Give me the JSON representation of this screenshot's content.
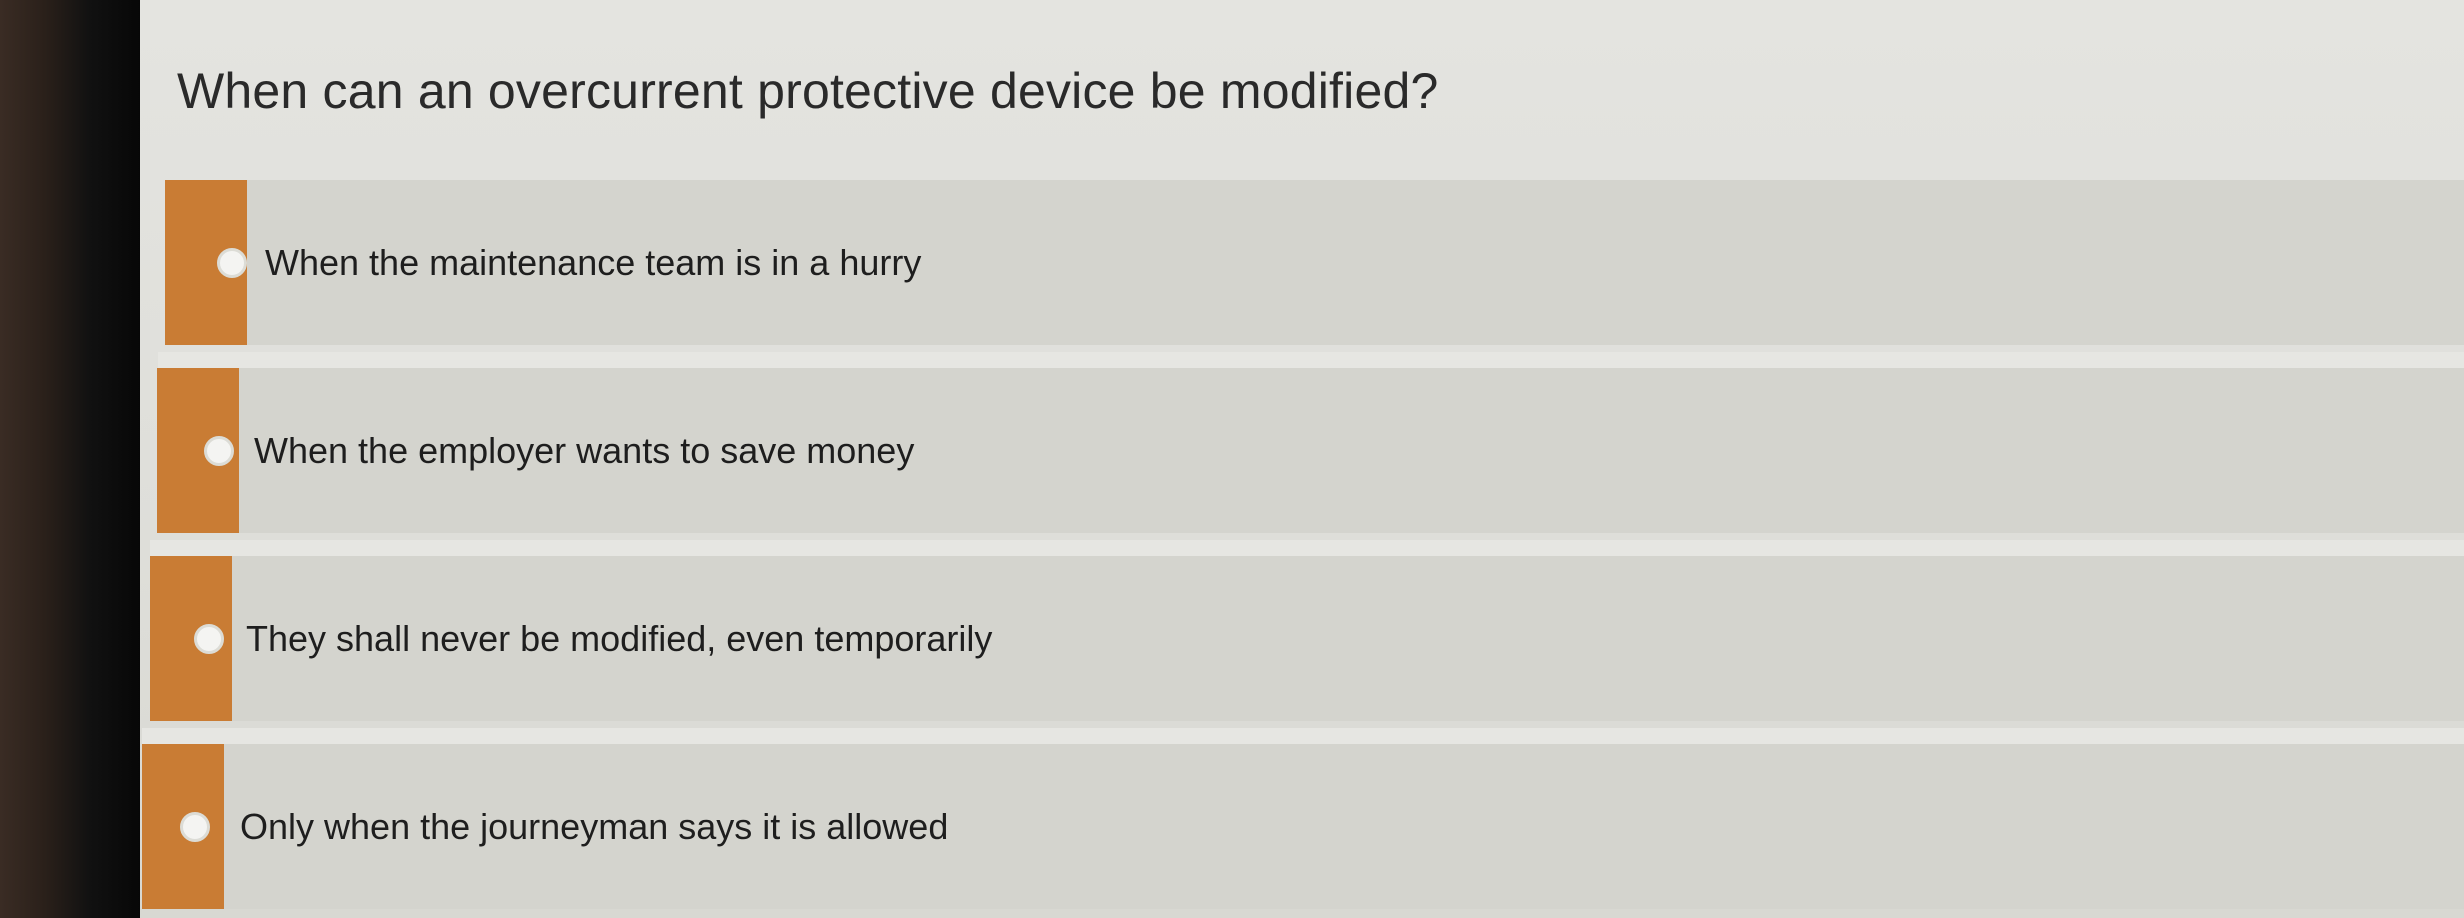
{
  "quiz": {
    "question": "When can an overcurrent protective device be modified?",
    "options": [
      {
        "label": "When the maintenance team is in a hurry"
      },
      {
        "label": "When the employer wants to save money"
      },
      {
        "label": "They shall never be modified, even temporarily"
      },
      {
        "label": "Only when the journeyman says it is allowed"
      }
    ],
    "accent_color": "#c97c34"
  }
}
